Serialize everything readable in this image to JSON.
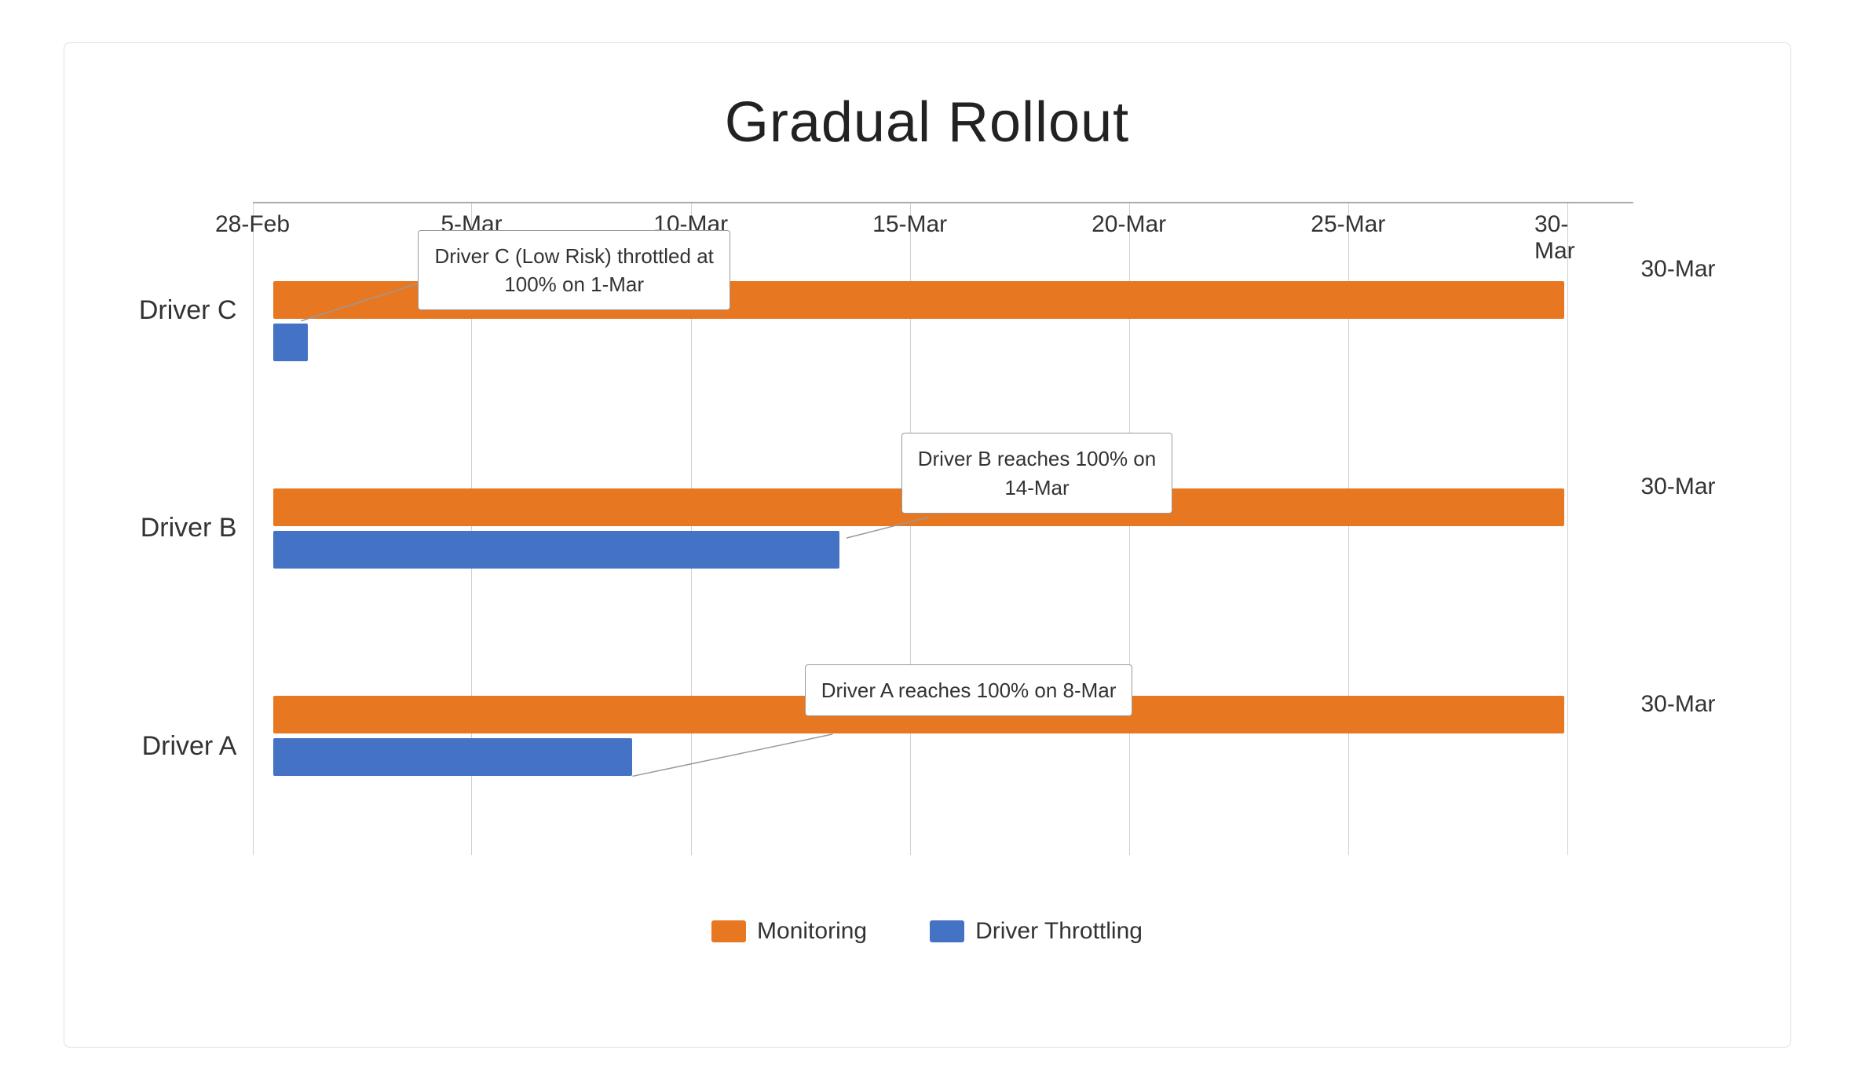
{
  "chart": {
    "title": "Gradual Rollout",
    "drivers": [
      {
        "id": "driver-c",
        "label": "Driver C",
        "right_label": "30-Mar"
      },
      {
        "id": "driver-b",
        "label": "Driver B",
        "right_label": "30-Mar"
      },
      {
        "id": "driver-a",
        "label": "Driver A",
        "right_label": "30-Mar"
      }
    ],
    "x_axis": {
      "labels": [
        "28-Feb",
        "5-Mar",
        "10-Mar",
        "15-Mar",
        "20-Mar",
        "25-Mar",
        "30-Mar"
      ],
      "positions": [
        0,
        15.87,
        31.75,
        47.62,
        63.49,
        79.37,
        95.24
      ]
    },
    "bars": {
      "driver_c": {
        "monitoring": {
          "start_pct": 1.5,
          "width_pct": 93.5
        },
        "throttling": {
          "start_pct": 1.5,
          "width_pct": 2.5
        }
      },
      "driver_b": {
        "monitoring": {
          "start_pct": 1.5,
          "width_pct": 93.5
        },
        "throttling": {
          "start_pct": 1.5,
          "width_pct": 41.0
        }
      },
      "driver_a": {
        "monitoring": {
          "start_pct": 1.5,
          "width_pct": 93.5
        },
        "throttling": {
          "start_pct": 1.5,
          "width_pct": 26.0
        }
      }
    },
    "annotations": [
      {
        "id": "ann-c",
        "text": "Driver C (Low Risk) throttled at\n100% on 1-Mar",
        "driver": "driver-c"
      },
      {
        "id": "ann-b",
        "text": "Driver B reaches 100% on\n14-Mar",
        "driver": "driver-b"
      },
      {
        "id": "ann-a",
        "text": "Driver A reaches 100% on 8-Mar",
        "driver": "driver-a"
      }
    ],
    "legend": {
      "items": [
        {
          "label": "Monitoring",
          "color": "#E87722"
        },
        {
          "label": "Driver Throttling",
          "color": "#4472C4"
        }
      ]
    }
  }
}
